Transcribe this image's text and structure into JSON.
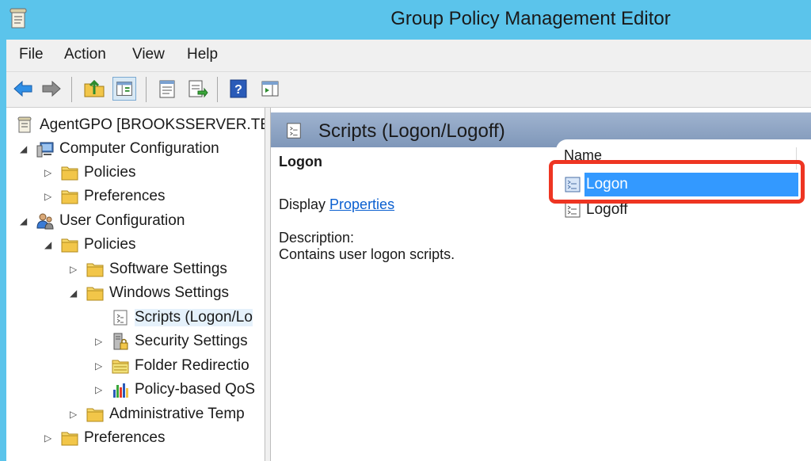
{
  "window": {
    "title": "Group Policy Management Editor"
  },
  "menu": [
    "File",
    "Action",
    "View",
    "Help"
  ],
  "toolbar": {
    "buttons": [
      "back-arrow-icon",
      "forward-arrow-icon",
      "up-folder-icon",
      "show-hide-tree-icon",
      "properties-icon",
      "export-list-icon",
      "help-icon",
      "action-pane-icon"
    ]
  },
  "tree": {
    "root": "AgentGPO [BROOKSSERVER.TEC",
    "computer_configuration": "Computer Configuration",
    "cc_policies": "Policies",
    "cc_preferences": "Preferences",
    "user_configuration": "User Configuration",
    "uc_policies": "Policies",
    "software_settings": "Software Settings",
    "windows_settings": "Windows Settings",
    "scripts": "Scripts (Logon/Lo",
    "security_settings": "Security Settings",
    "folder_redirection": "Folder Redirectio",
    "policy_qos": "Policy-based QoS",
    "admin_templates": "Administrative Temp",
    "uc_preferences": "Preferences"
  },
  "detail": {
    "header_title": "Scripts (Logon/Logoff)",
    "selected_name": "Logon",
    "display_label": "Display ",
    "properties_link": "Properties ",
    "description_label": "Description:",
    "description_text": "Contains user logon scripts.",
    "column_name": "Name",
    "items": [
      "Logon",
      "Logoff"
    ]
  },
  "colors": {
    "title_bar": "#5bc4eb",
    "selection": "#3399ff",
    "highlight": "#ee3522"
  }
}
